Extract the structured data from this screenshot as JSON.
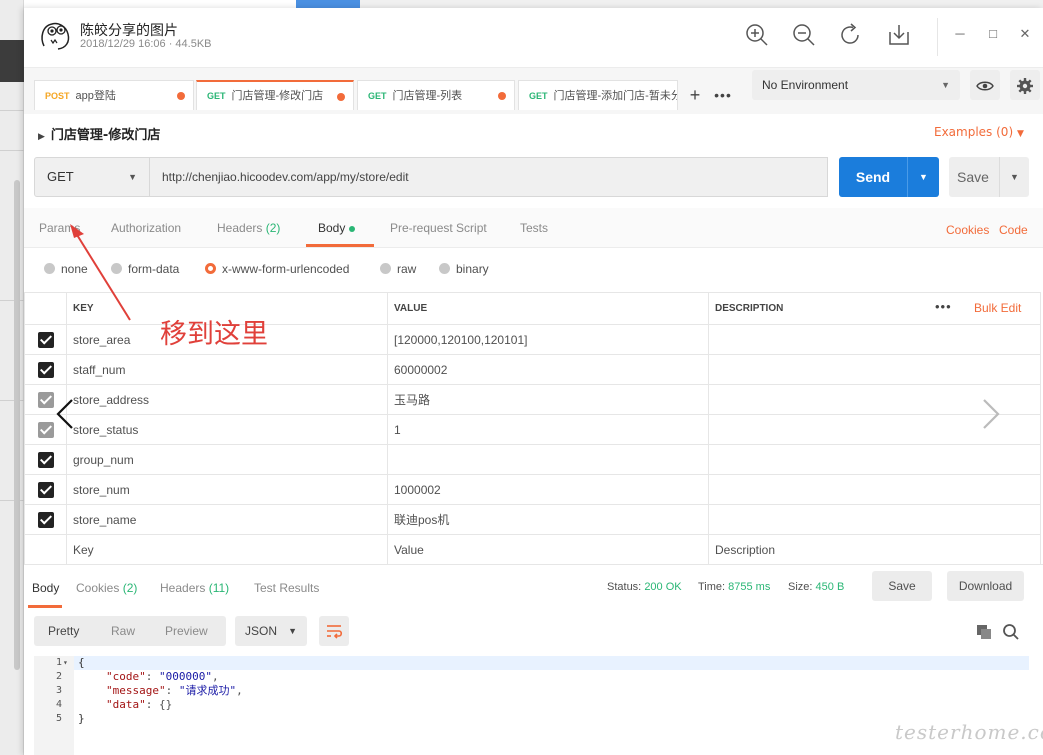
{
  "viewer": {
    "title": "陈皎分享的图片",
    "meta": "2018/12/29 16:06 · 44.5KB"
  },
  "tabs": [
    {
      "method": "POST",
      "label": "app登陆"
    },
    {
      "method": "GET",
      "label": "门店管理-修改门店"
    },
    {
      "method": "GET",
      "label": "门店管理-列表"
    },
    {
      "method": "GET",
      "label": "门店管理-添加门店-暂未分"
    }
  ],
  "env": {
    "label": "No Environment"
  },
  "request": {
    "title": "门店管理-修改门店",
    "examples": "Examples (0)",
    "method": "GET",
    "url": "http://chenjiao.hicoodev.com/app/my/store/edit",
    "send": "Send",
    "save": "Save"
  },
  "req_tabs": {
    "params": "Params",
    "authorization": "Authorization",
    "headers": "Headers",
    "headers_count": "(2)",
    "body": "Body",
    "prerequest": "Pre-request Script",
    "tests": "Tests",
    "cookies": "Cookies",
    "code": "Code"
  },
  "body_modes": [
    "none",
    "form-data",
    "x-www-form-urlencoded",
    "raw",
    "binary"
  ],
  "table": {
    "headers": [
      "KEY",
      "VALUE",
      "DESCRIPTION"
    ],
    "bulk_edit": "Bulk Edit",
    "rows": [
      {
        "key": "store_area",
        "value": "[120000,120100,120101]",
        "checked": true
      },
      {
        "key": "staff_num",
        "value": "60000002",
        "checked": true
      },
      {
        "key": "store_address",
        "value": "玉马路",
        "checked": true
      },
      {
        "key": "store_status",
        "value": "1",
        "checked": true
      },
      {
        "key": "group_num",
        "value": "",
        "checked": true
      },
      {
        "key": "store_num",
        "value": "1000002",
        "checked": true
      },
      {
        "key": "store_name",
        "value": "联迪pos机",
        "checked": true
      }
    ],
    "placeholder": {
      "key": "Key",
      "value": "Value",
      "description": "Description"
    }
  },
  "annotation": "移到这里",
  "response": {
    "tabs": {
      "body": "Body",
      "cookies": "Cookies",
      "cookies_count": "(2)",
      "headers": "Headers",
      "headers_count": "(11)",
      "results": "Test Results"
    },
    "status_label": "Status:",
    "status": "200 OK",
    "time_label": "Time:",
    "time": "8755 ms",
    "size_label": "Size:",
    "size": "450 B",
    "save": "Save",
    "download": "Download",
    "views": [
      "Pretty",
      "Raw",
      "Preview"
    ],
    "format": "JSON"
  },
  "code": {
    "lines": [
      "1",
      "2",
      "3",
      "4",
      "5"
    ],
    "l1": "{",
    "l2_key": "\"code\"",
    "l2_val": "\"000000\"",
    "l3_key": "\"message\"",
    "l3_val": "\"请求成功\"",
    "l4_key": "\"data\"",
    "l4_val": "{}",
    "l5": "}"
  },
  "watermark": "testerhome.com",
  "colors": {
    "accent": "#f26b3a",
    "send": "#1b7ddc",
    "success": "#2ab675",
    "annotation": "#e0403a"
  }
}
